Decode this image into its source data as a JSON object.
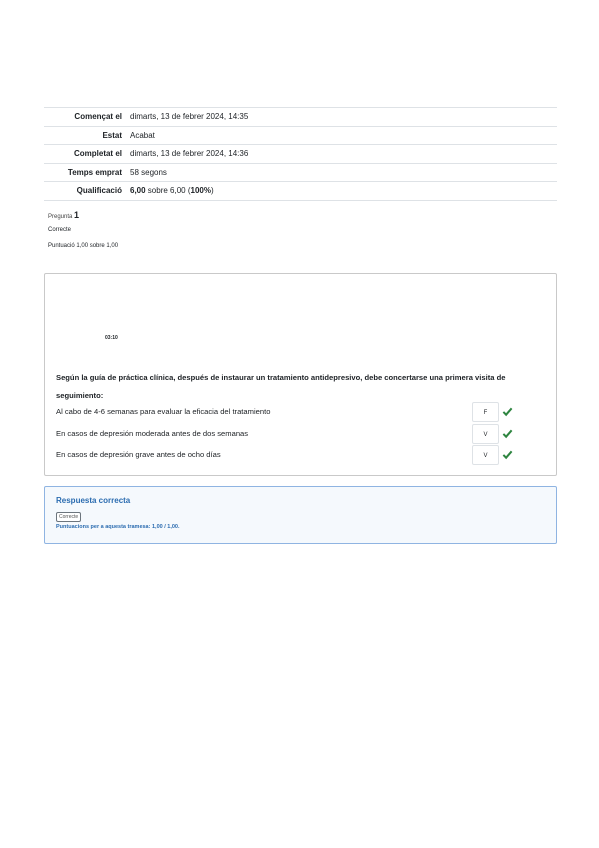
{
  "summary": [
    {
      "label": "Començat el",
      "value": "dimarts, 13 de febrer 2024, 14:35"
    },
    {
      "label": "Estat",
      "value": "Acabat"
    },
    {
      "label": "Completat el",
      "value": "dimarts, 13 de febrer 2024, 14:36"
    },
    {
      "label": "Temps emprat",
      "value": "58 segons"
    },
    {
      "label": "Qualificació",
      "value_bold": "6,00",
      "value_mid": " sobre 6,00 (",
      "value_pct": "100%",
      "value_end": ")"
    }
  ],
  "question": {
    "number_label": "Pregunta",
    "number": "1",
    "state": "Correcte",
    "grade": "Puntuació 1,00 sobre 1,00",
    "timer": "03:10",
    "text": "Según la guía de práctica clínica, después de instaurar un tratamiento antidepresivo, debe concertarse una primera visita de seguimiento:",
    "rows": [
      {
        "label": "Al cabo de 4-6 semanas para evaluar la eficacia del tratamiento",
        "answer": "F",
        "tick_color": "#2e8540"
      },
      {
        "label": "En casos de depresión moderada antes de dos semanas",
        "answer": "V",
        "tick_color": "#2e8540"
      },
      {
        "label": "En casos de depresión grave antes de ocho días",
        "answer": "V",
        "tick_color": "#2e8540"
      }
    ]
  },
  "feedback": {
    "title": "Respuesta correcta",
    "badge": "Correcte",
    "marks": "Puntuacions per a aquesta tramesa: 1,00 / 1,00."
  }
}
